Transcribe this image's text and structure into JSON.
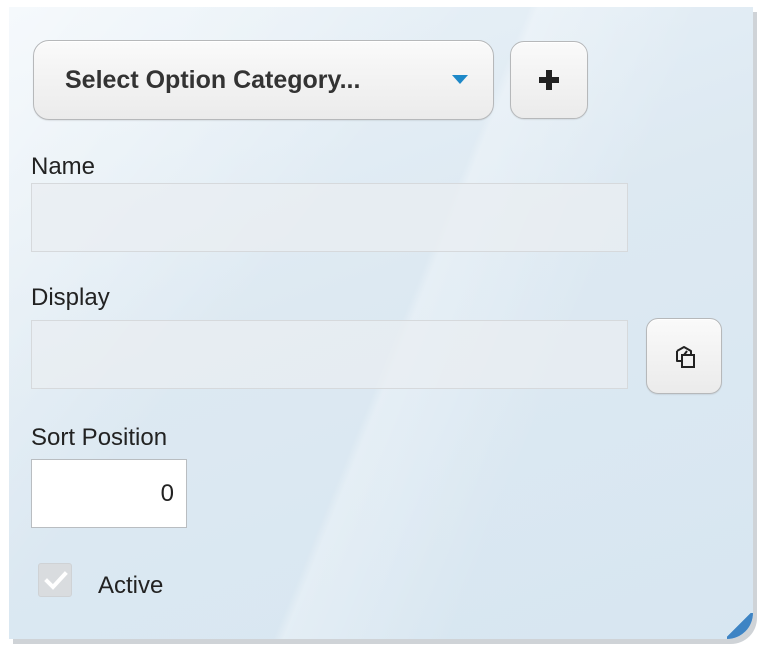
{
  "category": {
    "select_label": "Select Option Category...",
    "add_button_icon": "plus-icon"
  },
  "name": {
    "label": "Name",
    "value": ""
  },
  "display": {
    "label": "Display",
    "value": "",
    "copy_button_icon": "copy-icon"
  },
  "sort": {
    "label": "Sort Position",
    "value": "0"
  },
  "active": {
    "label": "Active",
    "checked": true,
    "disabled": true
  },
  "colors": {
    "dropdown_caret": "#1e88c8",
    "panel_corner_accent": "#3e84c4"
  }
}
